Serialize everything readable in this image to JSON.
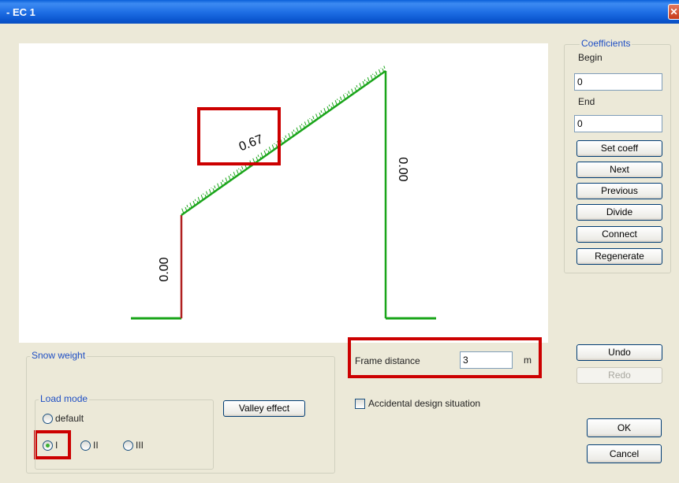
{
  "window": {
    "title": "- EC 1",
    "close_glyph": "✕"
  },
  "diagram": {
    "roof_value": "0.67",
    "left_wall_value": "0.00",
    "right_wall_value": "0.00",
    "colors": {
      "roof": "#1aa51a",
      "left_wall": "#b02020",
      "right_wall": "#1aa51a",
      "ground": "#1aa51a",
      "highlight": "#cc0000"
    }
  },
  "coefficients": {
    "legend": "Coefficients",
    "begin_label": "Begin",
    "begin_value": "0",
    "end_label": "End",
    "end_value": "0",
    "buttons": {
      "set_coeff": "Set coeff",
      "next": "Next",
      "previous": "Previous",
      "divide": "Divide",
      "connect": "Connect",
      "regenerate": "Regenerate"
    }
  },
  "snow_weight": {
    "legend": "Snow weight",
    "load_mode": {
      "legend": "Load mode",
      "options": [
        "default",
        "I",
        "II",
        "III"
      ],
      "selected": "I"
    },
    "valley_effect_label": "Valley effect"
  },
  "frame_distance": {
    "label": "Frame distance",
    "value": "3",
    "unit": "m"
  },
  "accidental": {
    "label": "Accidental design situation",
    "checked": false
  },
  "actions": {
    "undo": "Undo",
    "redo": "Redo",
    "ok": "OK",
    "cancel": "Cancel"
  }
}
